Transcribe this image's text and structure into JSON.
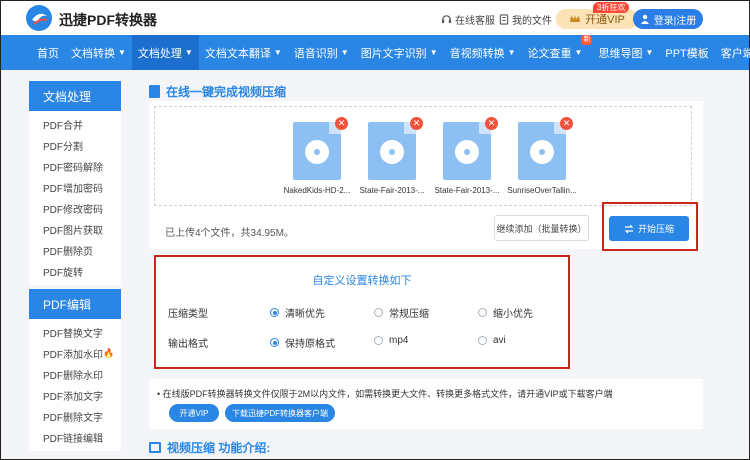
{
  "header": {
    "brand": "迅捷PDF转换器",
    "service": "在线客服",
    "my_files": "我的文件",
    "vip_badge": "3折狂欢",
    "vip_label": "开通VIP",
    "login": "登录|注册"
  },
  "nav": [
    {
      "label": "首页",
      "caret": false
    },
    {
      "label": "文档转换",
      "caret": true
    },
    {
      "label": "文档处理",
      "caret": true,
      "active": true
    },
    {
      "label": "文档文本翻译",
      "caret": true
    },
    {
      "label": "语音识别",
      "caret": true
    },
    {
      "label": "图片文字识别",
      "caret": true
    },
    {
      "label": "音视频转换",
      "caret": true
    },
    {
      "label": "论文查重",
      "caret": true,
      "badge": "新"
    },
    {
      "label": "思维导图",
      "caret": true
    },
    {
      "label": "PPT模板",
      "caret": false
    },
    {
      "label": "客户端",
      "caret": true
    }
  ],
  "sidebar": {
    "section1_title": "文档处理",
    "section1_items": [
      "PDF合并",
      "PDF分割",
      "PDF密码解除",
      "PDF增加密码",
      "PDF修改密码",
      "PDF图片获取",
      "PDF删除页",
      "PDF旋转"
    ],
    "section2_title": "PDF编辑",
    "section2_items": [
      "PDF替换文字",
      "PDF添加水印",
      "PDF删除水印",
      "PDF添加文字",
      "PDF删除文字",
      "PDF链接编辑"
    ]
  },
  "main": {
    "title": "在线一键完成视频压缩",
    "files": [
      "NakedKids-HD-2...",
      "State-Fair-2013-...",
      "State-Fair-2013-...",
      "SunriseOverTallin..."
    ],
    "upload_info": "已上传4个文件，共34.95M。",
    "continue_label": "继续添加（批量转换）",
    "start_label": "开始压缩"
  },
  "settings": {
    "title": "自定义设置转换如下",
    "compress_label": "压缩类型",
    "compress_options": [
      "清晰优先",
      "常规压缩",
      "缩小优先"
    ],
    "format_label": "输出格式",
    "format_options": [
      "保持原格式",
      "mp4",
      "avi"
    ]
  },
  "notice": {
    "text": "在线版PDF转换器转换文件仅限于2M以内文件，如需转换更大文件、转换更多格式文件，请开通VIP或下载客户端",
    "vip_button": "开通VIP",
    "download_button": "下载迅捷PDF转换器客户端"
  },
  "intro_title": "视频压缩 功能介绍:"
}
